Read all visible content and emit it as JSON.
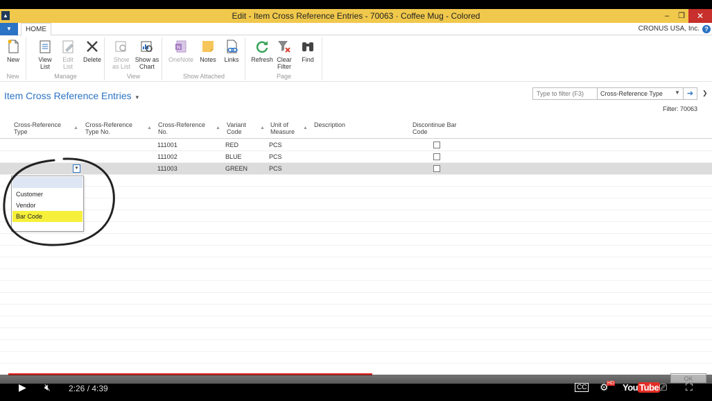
{
  "window": {
    "title": "Edit - Item Cross Reference Entries - 70063 · Coffee Mug - Colored",
    "app_icon": "nav-logo-icon",
    "minimize": "–",
    "maximize": "❐",
    "close": "✕"
  },
  "tabs": {
    "home": "HOME"
  },
  "company": "CRONUS USA, Inc.",
  "help": "?",
  "ribbon": {
    "groups": {
      "new": "New",
      "manage": "Manage",
      "view": "View",
      "show_attached": "Show Attached",
      "page": "Page"
    },
    "buttons": {
      "new": "New",
      "view_list": [
        "View",
        "List"
      ],
      "edit_list": [
        "Edit",
        "List"
      ],
      "delete": "Delete",
      "show_as_list": [
        "Show",
        "as List"
      ],
      "show_as_chart": [
        "Show as",
        "Chart"
      ],
      "onenote": "OneNote",
      "notes": "Notes",
      "links": "Links",
      "refresh": "Refresh",
      "clear_filter": [
        "Clear",
        "Filter"
      ],
      "find": "Find"
    }
  },
  "page": {
    "title": "Item Cross Reference Entries",
    "title_caret": "▾",
    "filter_placeholder": "Type to filter (F3)",
    "filter_field": "Cross-Reference Type",
    "filter_text": "Filter: 70063"
  },
  "columns": [
    [
      "Cross-Reference",
      "Type"
    ],
    [
      "Cross-Reference",
      "Type No."
    ],
    [
      "Cross-Reference",
      "No."
    ],
    [
      "Variant",
      "Code"
    ],
    [
      "Unit of",
      "Measure"
    ],
    [
      "Description"
    ],
    [
      "Discontinue Bar",
      "Code"
    ]
  ],
  "rows": [
    {
      "type": "",
      "type_no": "",
      "no": "111001",
      "variant": "RED",
      "uom": "PCS",
      "description": "",
      "discontinue": false
    },
    {
      "type": "",
      "type_no": "",
      "no": "111002",
      "variant": "BLUE",
      "uom": "PCS",
      "description": "",
      "discontinue": false
    },
    {
      "type": "",
      "type_no": "",
      "no": "111003",
      "variant": "GREEN",
      "uom": "PCS",
      "description": "",
      "discontinue": false
    }
  ],
  "dropdown": {
    "button": "▾",
    "options": [
      "",
      "Customer",
      "Vendor",
      "Bar Code"
    ],
    "highlighted": "Bar Code"
  },
  "player": {
    "time": "2:26 / 4:39",
    "progress": 0.523,
    "ok": "OK",
    "hd": "HD",
    "logo_you": "You",
    "logo_tube": "Tube"
  },
  "colors": {
    "titlebar": "#f0c84b",
    "accent": "#2b73c4",
    "highlight": "#f6f03b",
    "progress": "#e52d27"
  }
}
